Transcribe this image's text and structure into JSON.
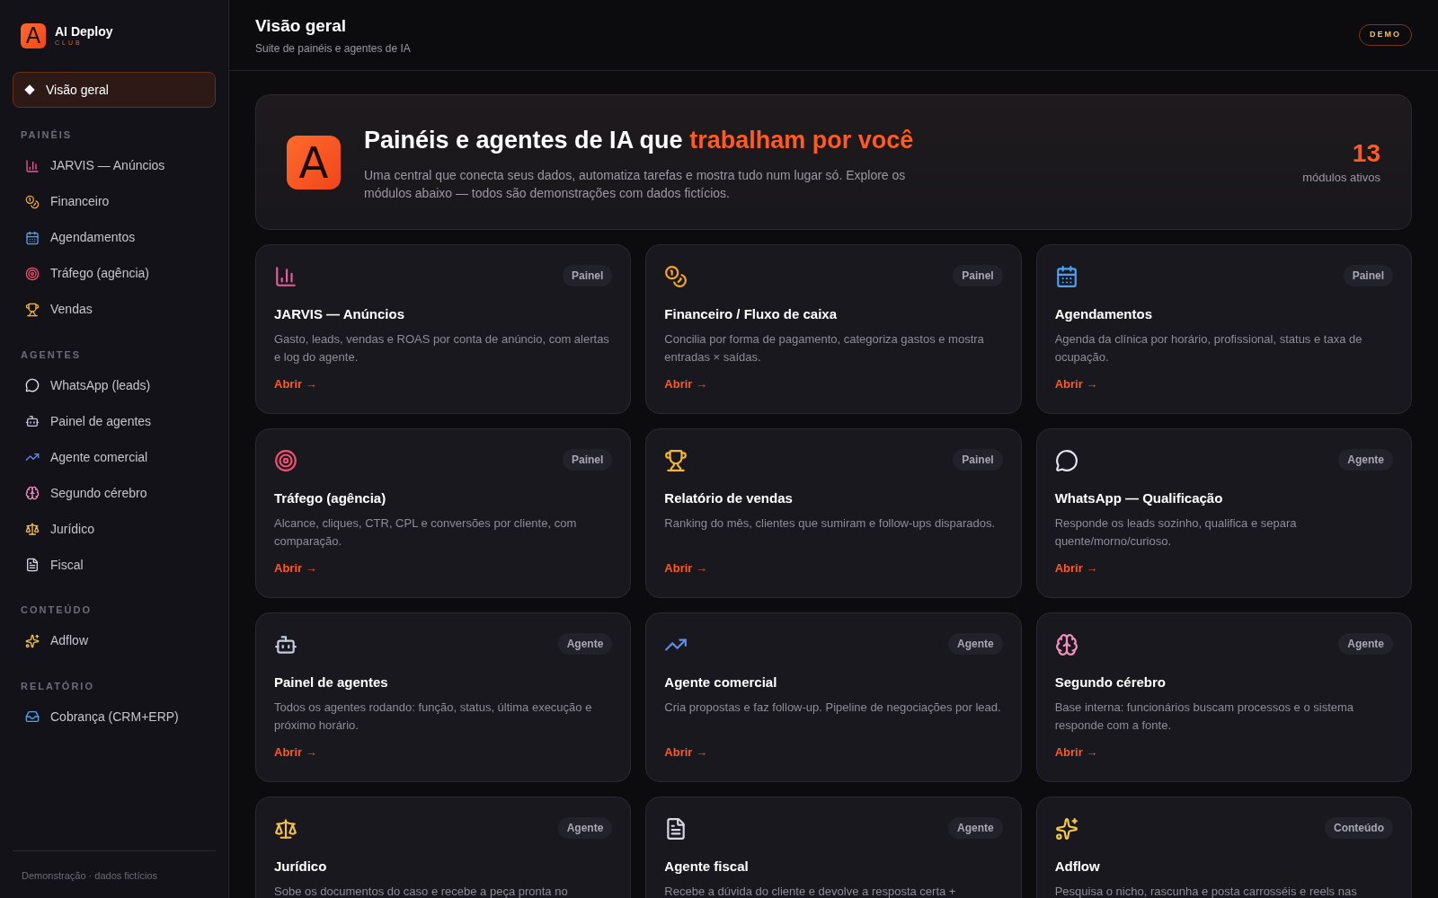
{
  "brand": {
    "name": "AI Deploy",
    "tagline": "CLUB",
    "logo_letter": "A"
  },
  "sidebar": {
    "home": {
      "label": "Visão geral",
      "selected": true
    },
    "sections": [
      {
        "title": "PAINÉIS",
        "items": [
          {
            "label": "JARVIS — Anúncios",
            "kind": "chart",
            "selected": false
          },
          {
            "label": "Financeiro",
            "kind": "money",
            "selected": false
          },
          {
            "label": "Agendamentos",
            "kind": "calendar",
            "selected": false
          },
          {
            "label": "Tráfego (agência)",
            "kind": "target",
            "selected": false
          },
          {
            "label": "Vendas",
            "kind": "trophy",
            "selected": false
          }
        ]
      },
      {
        "title": "AGENTES",
        "items": [
          {
            "label": "WhatsApp (leads)",
            "kind": "chat",
            "selected": false
          },
          {
            "label": "Painel de agentes",
            "kind": "robot",
            "selected": false
          },
          {
            "label": "Agente comercial",
            "kind": "trend",
            "selected": false
          },
          {
            "label": "Segundo cérebro",
            "kind": "brain",
            "selected": false
          },
          {
            "label": "Jurídico",
            "kind": "scales",
            "selected": false
          },
          {
            "label": "Fiscal",
            "kind": "document",
            "selected": false
          }
        ]
      },
      {
        "title": "CONTEÚDO",
        "items": [
          {
            "label": "Adflow",
            "kind": "sparkles",
            "selected": false
          }
        ]
      },
      {
        "title": "RELATÓRIO",
        "items": [
          {
            "label": "Cobrança (CRM+ERP)",
            "kind": "inbox",
            "selected": false
          }
        ]
      }
    ],
    "footer": "Demonstração · dados fictícios"
  },
  "header": {
    "title": "Visão geral",
    "subtitle": "Suite de painéis e agentes de IA",
    "badge": "DEMO"
  },
  "hero": {
    "logo_letter": "A",
    "headline": "Painéis e agentes de IA que",
    "headline_accent": "trabalham por você",
    "description": "Uma central que conecta seus dados, automatiza tarefas e mostra tudo num lugar só. Explore os módulos abaixo — todos são demonstrações com dados fictícios.",
    "count": "13",
    "count_label": "módulos ativos"
  },
  "modules": [
    {
      "kind": "chart",
      "tag": "Painel",
      "title": "JARVIS — Anúncios",
      "description": "Gasto, leads, vendas e ROAS por conta de anúncio, com alertas e log do agente.",
      "link": "Abrir →"
    },
    {
      "kind": "money",
      "tag": "Painel",
      "title": "Financeiro / Fluxo de caixa",
      "description": "Concilia por forma de pagamento, categoriza gastos e mostra entradas × saídas.",
      "link": "Abrir →"
    },
    {
      "kind": "calendar",
      "tag": "Painel",
      "title": "Agendamentos",
      "description": "Agenda da clínica por horário, profissional, status e taxa de ocupação.",
      "link": "Abrir →"
    },
    {
      "kind": "target",
      "tag": "Painel",
      "title": "Tráfego (agência)",
      "description": "Alcance, cliques, CTR, CPL e conversões por cliente, com comparação.",
      "link": "Abrir →"
    },
    {
      "kind": "trophy",
      "tag": "Painel",
      "title": "Relatório de vendas",
      "description": "Ranking do mês, clientes que sumiram e follow-ups disparados.",
      "link": "Abrir →"
    },
    {
      "kind": "chat",
      "tag": "Agente",
      "title": "WhatsApp — Qualificação",
      "description": "Responde os leads sozinho, qualifica e separa quente/morno/curioso.",
      "link": "Abrir →"
    },
    {
      "kind": "robot",
      "tag": "Agente",
      "title": "Painel de agentes",
      "description": "Todos os agentes rodando: função, status, última execução e próximo horário.",
      "link": "Abrir →"
    },
    {
      "kind": "trend",
      "tag": "Agente",
      "title": "Agente comercial",
      "description": "Cria propostas e faz follow-up. Pipeline de negociações por lead.",
      "link": "Abrir →"
    },
    {
      "kind": "brain",
      "tag": "Agente",
      "title": "Segundo cérebro",
      "description": "Base interna: funcionários buscam processos e o sistema responde com a fonte.",
      "link": "Abrir →"
    },
    {
      "kind": "scales",
      "tag": "Agente",
      "title": "Jurídico",
      "description": "Sobe os documentos do caso e recebe a peça pronta no"
    },
    {
      "kind": "document",
      "tag": "Agente",
      "title": "Agente fiscal",
      "description": "Recebe a dúvida do cliente e devolve a resposta certa +"
    },
    {
      "kind": "sparkles",
      "tag": "Conteúdo",
      "title": "Adflow",
      "description": "Pesquisa o nicho, rascunha e posta carrosséis e reels nas"
    }
  ]
}
